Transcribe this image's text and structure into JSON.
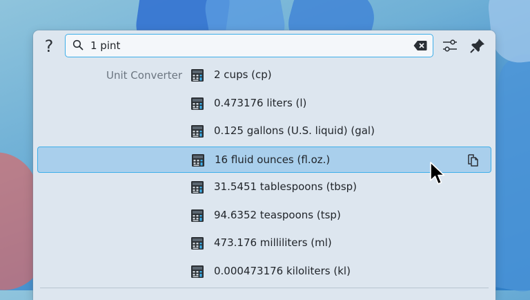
{
  "topbar": {
    "help_label": "?",
    "search_value": "1 pint",
    "icons": [
      "search-icon",
      "backspace-clear-icon",
      "sliders-icon",
      "pin-icon"
    ]
  },
  "category": "Unit Converter",
  "results": [
    {
      "text": "2 cups (cp)",
      "icon": "calculator-icon"
    },
    {
      "text": "0.473176 liters (l)",
      "icon": "calculator-icon"
    },
    {
      "text": "0.125 gallons (U.S. liquid) (gal)",
      "icon": "calculator-icon"
    },
    {
      "text": "16 fluid ounces (fl.oz.)",
      "icon": "calculator-icon",
      "selected": true
    },
    {
      "text": "31.5451 tablespoons (tbsp)",
      "icon": "calculator-icon"
    },
    {
      "text": "94.6352 teaspoons (tsp)",
      "icon": "calculator-icon"
    },
    {
      "text": "473.176 milliliters (ml)",
      "icon": "calculator-icon"
    },
    {
      "text": "0.000473176 kiloliters (kl)",
      "icon": "calculator-icon"
    }
  ],
  "colors": {
    "accent": "#3daee9",
    "selection": "#a9cfec",
    "panel": "#dde6ef"
  }
}
